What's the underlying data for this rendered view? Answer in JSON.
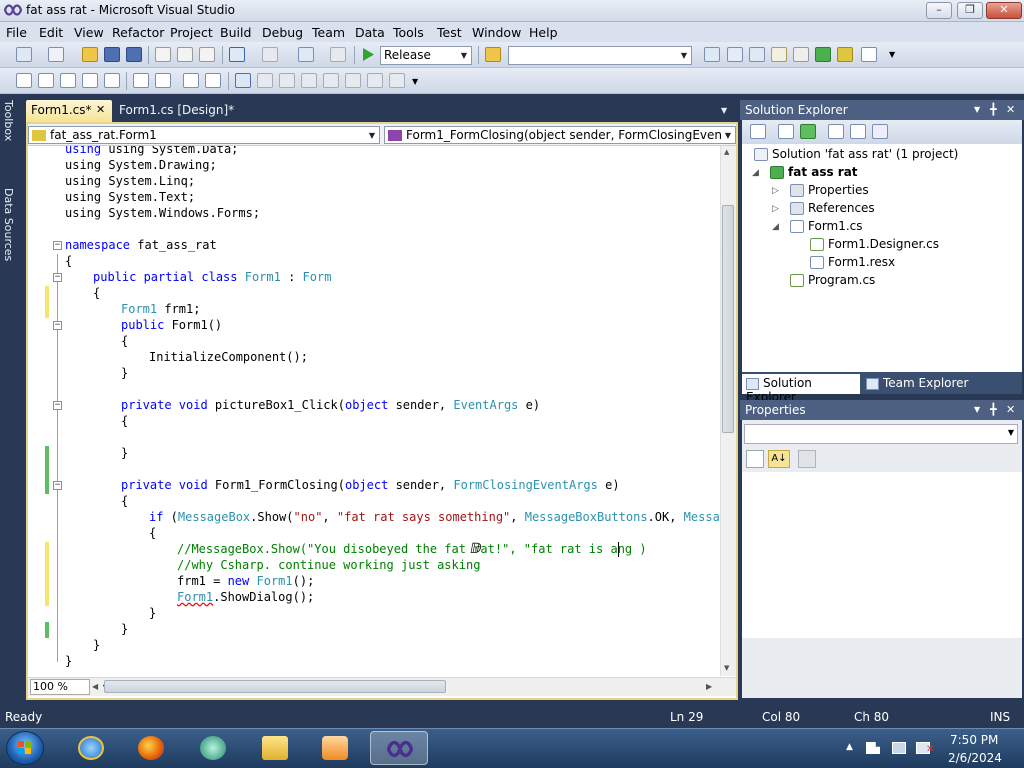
{
  "window": {
    "title": "fat ass rat - Microsoft Visual Studio",
    "minimize": "–",
    "maximize": "❐",
    "close": "✕"
  },
  "menu": [
    "File",
    "Edit",
    "View",
    "Refactor",
    "Project",
    "Build",
    "Debug",
    "Team",
    "Data",
    "Tools",
    "Test",
    "Window",
    "Help"
  ],
  "toolbar": {
    "configuration": "Release",
    "platform_combo": ""
  },
  "side_tabs": [
    "Toolbox",
    "Data Sources"
  ],
  "editor": {
    "tabs": [
      "Form1.cs*",
      "Form1.cs [Design]*"
    ],
    "class_combo": "fat_ass_rat.Form1",
    "member_combo": "Form1_FormClosing(object sender, FormClosingEventArgs e)",
    "zoom": "100 %"
  },
  "code": {
    "l1": "using System.Data;",
    "l2": "using System.Drawing;",
    "l3": "using System.Linq;",
    "l4": "using System.Text;",
    "l5": "using System.Windows.Forms;",
    "ns_kw": "namespace",
    "ns_name": " fat_ass_rat",
    "open_brace": "{",
    "close_brace": "}",
    "class_mods": "public partial class",
    "class_name": " Form1",
    "class_colon": " : ",
    "class_base": "Form",
    "field_type": "Form1",
    "field_name": " frm1;",
    "ctor_kw": "public",
    "ctor_name": " Form1()",
    "init_call": "InitializeComponent();",
    "m1_mods": "private void",
    "m1_name": " pictureBox1_Click(",
    "m1_p1": "object",
    "m1_p1n": " sender, ",
    "m1_p2": "EventArgs",
    "m1_p2n": " e)",
    "m2_mods": "private void",
    "m2_name": " Form1_FormClosing(",
    "m2_p1": "object",
    "m2_p1n": " sender, ",
    "m2_p2": "FormClosingEventArgs",
    "m2_p2n": " e)",
    "if_kw": "if",
    "if_open": " (",
    "if_type": "MessageBox",
    "if_show": ".Show(",
    "if_s1": "\"no\"",
    "if_comma": ", ",
    "if_s2": "\"fat rat says something\"",
    "if_comma2": ", ",
    "if_type2": "MessageBoxButtons",
    "if_ok": ".OK, ",
    "if_type3": "MessageB",
    "c1": "//MessageBox.Show(\"You disobeyed the fat rat!\", \"fat rat is ang )",
    "c2": "//why Csharp. continue working just asking",
    "assign_pre": "frm1 = ",
    "assign_new": "new",
    "assign_sp": " ",
    "assign_type": "Form1",
    "assign_end": "();",
    "show_type": "Form1",
    "show_call": ".ShowDialog();"
  },
  "solution_explorer": {
    "title": "Solution Explorer",
    "nodes": {
      "solution": "Solution 'fat ass rat' (1 project)",
      "project": "fat ass rat",
      "properties": "Properties",
      "references": "References",
      "form1": "Form1.cs",
      "designer": "Form1.Designer.cs",
      "resx": "Form1.resx",
      "program": "Program.cs"
    },
    "tabs": [
      "Solution Explorer",
      "Team Explorer"
    ]
  },
  "properties_panel": {
    "title": "Properties"
  },
  "status": {
    "state": "Ready",
    "ln": "Ln 29",
    "col": "Col 80",
    "ch": "Ch 80",
    "ins": "INS"
  },
  "taskbar": {
    "time": "7:50 PM",
    "date": "2/6/2024"
  },
  "colors": {
    "keyword": "#0000ff",
    "type": "#2b91af",
    "string": "#a31515",
    "comment": "#008000",
    "chrome": "#293955"
  }
}
